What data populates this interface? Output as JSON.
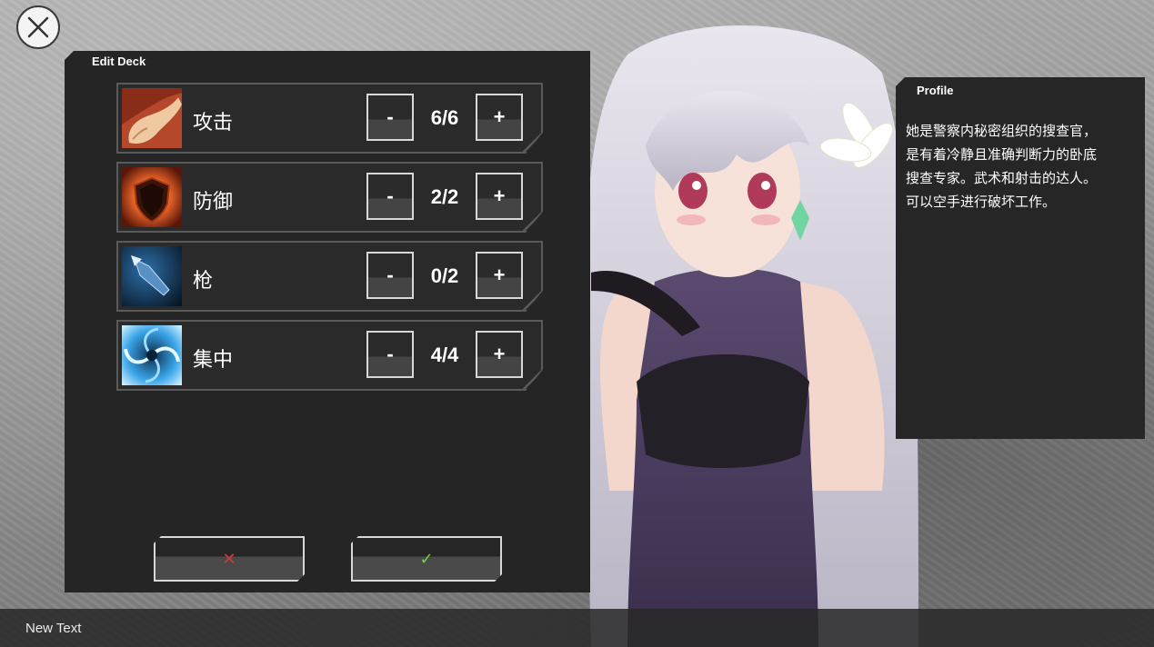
{
  "close_button": {
    "icon": "close-icon"
  },
  "deck": {
    "title": "Edit Deck",
    "rows": [
      {
        "label": "攻击",
        "count": "6/6",
        "icon": "fist-icon"
      },
      {
        "label": "防御",
        "count": "2/2",
        "icon": "shield-icon"
      },
      {
        "label": "枪",
        "count": "0/2",
        "icon": "bullet-icon"
      },
      {
        "label": "集中",
        "count": "4/4",
        "icon": "vortex-icon"
      }
    ],
    "minus_label": "-",
    "plus_label": "+",
    "cancel_symbol": "✕",
    "confirm_symbol": "✓",
    "cancel_color": "#d23a3a",
    "confirm_color": "#6fd04a"
  },
  "profile": {
    "title": "Profile",
    "text": "她是警察内秘密组织的搜查官，\n是有着冷静且准确判断力的卧底\n搜查专家。武术和射击的达人。\n可以空手进行破坏工作。"
  },
  "footer": {
    "text": "New Text"
  }
}
